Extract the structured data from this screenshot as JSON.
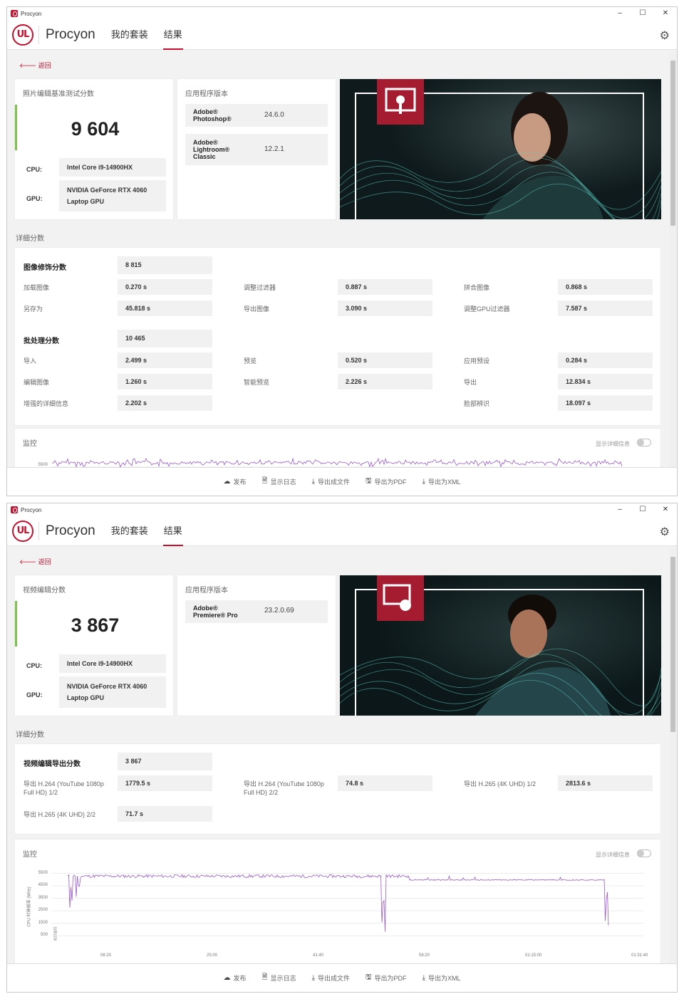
{
  "window_title": "Procyon",
  "brand": "Procyon",
  "nav": {
    "my_suites": "我的套装",
    "results": "结果"
  },
  "back_label": "返回",
  "footer": {
    "publish": "发布",
    "show_log": "显示日志",
    "export_file": "导出成文件",
    "export_pdf": "导出为PDF",
    "export_xml": "导出为XML"
  },
  "monitor_label": "监控",
  "show_detail_label": "显示详细信息",
  "details_label": "详细分数",
  "app_version_label": "应用程序版本",
  "hw": {
    "cpu_label": "CPU:",
    "cpu": "Intel Core i9-14900HX",
    "gpu_label": "GPU:",
    "gpu_line1": "NVIDIA GeForce RTX 4060",
    "gpu_line2": "Laptop GPU"
  },
  "photo": {
    "score_title": "照片编辑基准测试分数",
    "score": "9 604",
    "apps": [
      {
        "name1": "Adobe®",
        "name2": "Photoshop®",
        "name3": "",
        "version": "24.6.0"
      },
      {
        "name1": "Adobe®",
        "name2": "Lightroom®",
        "name3": "Classic",
        "version": "12.2.1"
      }
    ],
    "groups": [
      {
        "title": "图像修饰分数",
        "score": "8 815",
        "rows": [
          [
            {
              "l": "加载图像",
              "v": "0.270 s"
            },
            {
              "l": "调整过滤器",
              "v": "0.887 s"
            },
            {
              "l": "拼合图像",
              "v": "0.868 s"
            }
          ],
          [
            {
              "l": "另存为",
              "v": "45.818 s"
            },
            {
              "l": "导出图像",
              "v": "3.090 s"
            },
            {
              "l": "调整GPU过滤器",
              "v": "7.587 s"
            }
          ]
        ]
      },
      {
        "title": "批处理分数",
        "score": "10 465",
        "rows": [
          [
            {
              "l": "导入",
              "v": "2.499 s"
            },
            {
              "l": "预览",
              "v": "0.520 s"
            },
            {
              "l": "应用预设",
              "v": "0.284 s"
            }
          ],
          [
            {
              "l": "编辑图像",
              "v": "1.260 s"
            },
            {
              "l": "智能预览",
              "v": "2.226 s"
            },
            {
              "l": "导出",
              "v": "12.834 s"
            }
          ],
          [
            {
              "l": "增强的详细信息",
              "v": "2.202 s"
            },
            {
              "l": "",
              "v": ""
            },
            {
              "l": "脸部辨识",
              "v": "18.097 s"
            }
          ]
        ]
      }
    ],
    "monitor_ytick": "5500"
  },
  "video": {
    "score_title": "视频编辑分数",
    "score": "3 867",
    "apps": [
      {
        "name1": "Adobe®",
        "name2": "Premiere® Pro",
        "name3": "",
        "version": "23.2.0.69"
      }
    ],
    "group_title": "视频编辑导出分数",
    "group_score": "3 867",
    "items": [
      {
        "l1": "导出 H.264 (YouTube 1080p",
        "l2": "Full HD) 1/2",
        "v": "1779.5 s"
      },
      {
        "l1": "导出 H.264 (YouTube 1080p",
        "l2": "Full HD) 2/2",
        "v": "74.8 s"
      },
      {
        "l1": "导出 H.265 (4K UHD) 1/2",
        "l2": "",
        "v": "2813.6 s"
      },
      {
        "l1": "导出 H.265 (4K UHD) 2/2",
        "l2": "",
        "v": "71.7 s"
      }
    ],
    "chart_data": {
      "type": "line",
      "ylabel": "CPU 时钟频率 (MHz)",
      "yticks": [
        "5500",
        "4500",
        "3500",
        "2500",
        "1500",
        "500"
      ],
      "xticks": [
        "08:20",
        "25:00",
        "41:40",
        "58:20",
        "01:15:00",
        "01:31:40"
      ],
      "ylim": [
        0,
        5700
      ],
      "series_note": "视频编辑"
    }
  },
  "colors": {
    "accent": "#c8102e",
    "score_bar": "#7dc24b",
    "chart_line": "#9b59d0"
  }
}
